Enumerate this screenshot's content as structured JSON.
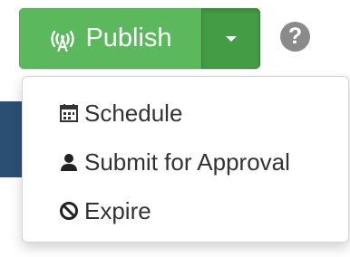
{
  "publish": {
    "label": "Publish",
    "icon": "broadcast-icon",
    "color": "#5cb85c",
    "toggle_color": "#449d44"
  },
  "help": {
    "icon": "question-circle-icon",
    "glyph": "?"
  },
  "menu": {
    "items": [
      {
        "label": "Schedule",
        "icon": "calendar-icon"
      },
      {
        "label": "Submit for Approval",
        "icon": "user-icon"
      },
      {
        "label": "Expire",
        "icon": "ban-icon"
      }
    ]
  }
}
